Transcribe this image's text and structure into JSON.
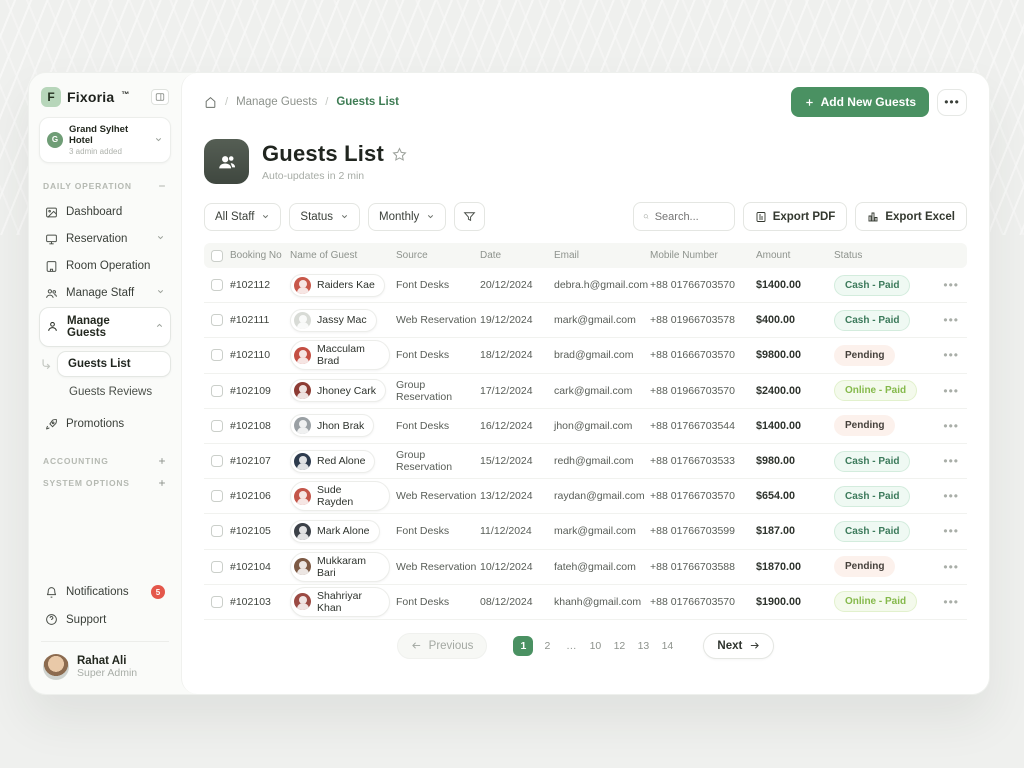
{
  "brand": {
    "name": "Fixoria",
    "tm": "™",
    "logo_letter": "F"
  },
  "hotel": {
    "name": "Grand Sylhet Hotel",
    "sub": "3 admin added",
    "avatar_letter": "G"
  },
  "sidebar": {
    "section_daily": "DAILY OPERATION",
    "section_accounting": "ACCOUNTING",
    "section_system": "SYSTEM OPTIONS",
    "items": [
      {
        "label": "Dashboard"
      },
      {
        "label": "Reservation"
      },
      {
        "label": "Room Operation"
      },
      {
        "label": "Manage Staff"
      },
      {
        "label": "Manage Guests"
      },
      {
        "label": "Guests List"
      },
      {
        "label": "Guests Reviews"
      },
      {
        "label": "Promotions"
      }
    ],
    "notifications_label": "Notifications",
    "notifications_badge": "5",
    "support_label": "Support",
    "user": {
      "name": "Rahat Ali",
      "role": "Super Admin"
    }
  },
  "breadcrumb": {
    "level1": "Manage Guests",
    "level2": "Guests List"
  },
  "header_actions": {
    "add_button": "Add New Guests",
    "more": "..."
  },
  "page": {
    "title": "Guests List",
    "subtitle": "Auto-updates in 2 min"
  },
  "filters": {
    "staff": "All Staff",
    "status": "Status",
    "period": "Monthly"
  },
  "search": {
    "placeholder": "Search..."
  },
  "exports": {
    "pdf": "Export PDF",
    "excel": "Export Excel"
  },
  "table": {
    "columns": [
      "Booking No",
      "Name of Guest",
      "Source",
      "Date",
      "Email",
      "Mobile Number",
      "Amount",
      "Status"
    ],
    "rows": [
      {
        "booking": "#102112",
        "name": "Raiders Kae",
        "avatar_color": "#c8584a",
        "source": "Font Desks",
        "date": "20/12/2024",
        "email": "debra.h@gmail.com",
        "mobile": "+88 01766703570",
        "amount": "$1400.00",
        "status": "Cash - Paid",
        "status_class": "cash"
      },
      {
        "booking": "#102111",
        "name": "Jassy Mac",
        "avatar_color": "#d8dbd6",
        "source": "Web Reservation",
        "date": "19/12/2024",
        "email": "mark@gmail.com",
        "mobile": "+88 01966703578",
        "amount": "$400.00",
        "status": "Cash - Paid",
        "status_class": "cash"
      },
      {
        "booking": "#102110",
        "name": "Macculam Brad",
        "avatar_color": "#c44f43",
        "source": "Font Desks",
        "date": "18/12/2024",
        "email": "brad@gmail.com",
        "mobile": "+88 01666703570",
        "amount": "$9800.00",
        "status": "Pending",
        "status_class": "pending"
      },
      {
        "booking": "#102109",
        "name": "Jhoney Cark",
        "avatar_color": "#8d3c34",
        "source": "Group Reservation",
        "date": "17/12/2024",
        "email": "cark@gmail.com",
        "mobile": "+88 01966703570",
        "amount": "$2400.00",
        "status": "Online - Paid",
        "status_class": "online"
      },
      {
        "booking": "#102108",
        "name": "Jhon Brak",
        "avatar_color": "#9aa0a4",
        "source": "Font Desks",
        "date": "16/12/2024",
        "email": "jhon@gmail.com",
        "mobile": "+88 01766703544",
        "amount": "$1400.00",
        "status": "Pending",
        "status_class": "pending"
      },
      {
        "booking": "#102107",
        "name": "Red Alone",
        "avatar_color": "#2e3c4e",
        "source": "Group Reservation",
        "date": "15/12/2024",
        "email": "redh@gmail.com",
        "mobile": "+88 01766703533",
        "amount": "$980.00",
        "status": "Cash - Paid",
        "status_class": "cash"
      },
      {
        "booking": "#102106",
        "name": "Sude Rayden",
        "avatar_color": "#c4564a",
        "source": "Web Reservation",
        "date": "13/12/2024",
        "email": "raydan@gmail.com",
        "mobile": "+88 01766703570",
        "amount": "$654.00",
        "status": "Cash - Paid",
        "status_class": "cash"
      },
      {
        "booking": "#102105",
        "name": "Mark Alone",
        "avatar_color": "#3c4148",
        "source": "Font Desks",
        "date": "11/12/2024",
        "email": "mark@gmail.com",
        "mobile": "+88 01766703599",
        "amount": "$187.00",
        "status": "Cash - Paid",
        "status_class": "cash"
      },
      {
        "booking": "#102104",
        "name": "Mukkaram Bari",
        "avatar_color": "#7d5a44",
        "source": "Web Reservation",
        "date": "10/12/2024",
        "email": "fateh@gmail.com",
        "mobile": "+88 01766703588",
        "amount": "$1870.00",
        "status": "Pending",
        "status_class": "pending"
      },
      {
        "booking": "#102103",
        "name": "Shahriyar Khan",
        "avatar_color": "#9b4a43",
        "source": "Font Desks",
        "date": "08/12/2024",
        "email": "khanh@gmail.com",
        "mobile": "+88 01766703570",
        "amount": "$1900.00",
        "status": "Online - Paid",
        "status_class": "online"
      }
    ]
  },
  "pagination": {
    "previous": "Previous",
    "next": "Next",
    "pages": [
      {
        "label": "1",
        "state": "active"
      },
      {
        "label": "2",
        "state": ""
      },
      {
        "label": "…",
        "state": ""
      },
      {
        "label": "10",
        "state": ""
      },
      {
        "label": "12",
        "state": ""
      },
      {
        "label": "13",
        "state": ""
      },
      {
        "label": "14",
        "state": ""
      }
    ]
  },
  "colors": {
    "accent_green": "#4a9162",
    "badge_red": "#e4574b",
    "status_cash": "#3c7a5b",
    "status_online": "#85b94b"
  }
}
